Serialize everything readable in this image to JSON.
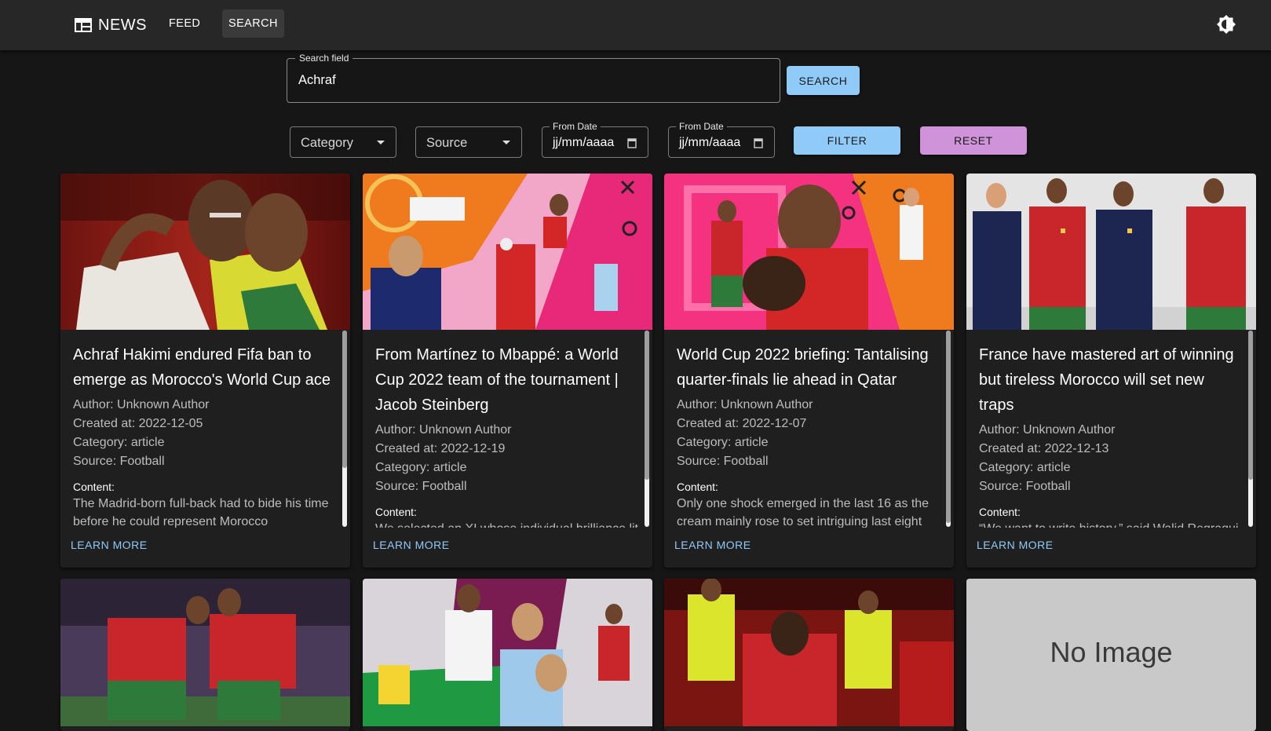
{
  "header": {
    "brand": "NEWS",
    "nav": {
      "feed": "FEED",
      "search": "SEARCH"
    }
  },
  "search": {
    "legend": "Search field",
    "value": "Achraf",
    "button": "SEARCH"
  },
  "filters": {
    "category": "Category",
    "source": "Source",
    "from_date_1": {
      "legend": "From Date",
      "value": "jj/mm/aaaa"
    },
    "from_date_2": {
      "legend": "From Date",
      "value": "jj/mm/aaaa"
    },
    "filter_button": "FILTER",
    "reset_button": "RESET"
  },
  "colors": {
    "primary": "#90caf9",
    "secondary": "#ce93d8",
    "appbar": "#272727",
    "background": "#161616",
    "card": "#1f1f1f"
  },
  "cards": [
    {
      "title": "Achraf Hakimi endured Fifa ban to emerge as Morocco's World Cup ace",
      "author": "Author: Unknown Author",
      "created": "Created at: 2022-12-05",
      "category": "Category: article",
      "source": "Source: Football",
      "content_label": "Content:",
      "content": "The Madrid-born full-back had to bide his time before he could represent Morocco",
      "action": "LEARN MORE"
    },
    {
      "title": "From Martínez to Mbappé: a World Cup 2022 team of the tournament | Jacob Steinberg",
      "author": "Author: Unknown Author",
      "created": "Created at: 2022-12-19",
      "category": "Category: article",
      "source": "Source: Football",
      "content_label": "Content:",
      "content": "We selected an XI whose individual brilliance lit up the tournament",
      "action": "LEARN MORE"
    },
    {
      "title": "World Cup 2022 briefing: Tantalising quarter-finals lie ahead in Qatar",
      "author": "Author: Unknown Author",
      "created": "Created at: 2022-12-07",
      "category": "Category: article",
      "source": "Source: Football",
      "content_label": "Content:",
      "content": "Only one shock emerged in the last 16 as the cream mainly rose to set intriguing last eight",
      "action": "LEARN MORE"
    },
    {
      "title": "France have mastered art of winning but tireless Morocco will set new traps",
      "author": "Author: Unknown Author",
      "created": "Created at: 2022-12-13",
      "category": "Category: article",
      "source": "Source: Football",
      "content_label": "Content:",
      "content": "“We want to write history,” said Walid Regragui ahead of the semi-final",
      "action": "LEARN MORE"
    }
  ],
  "no_image_text": "No Image"
}
